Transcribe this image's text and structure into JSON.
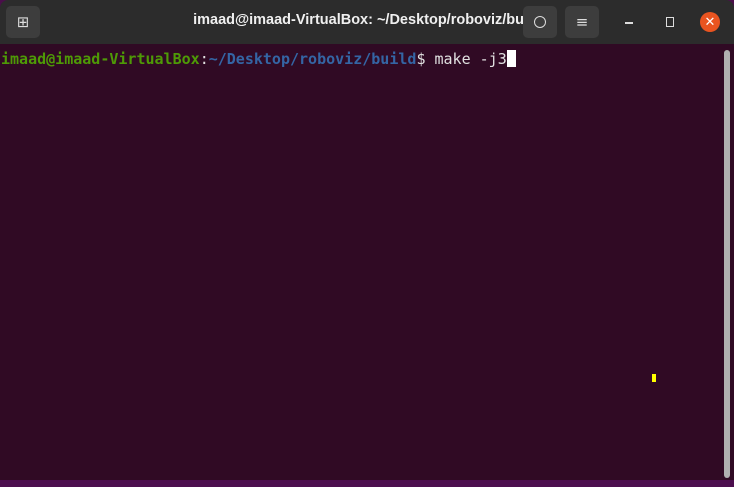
{
  "window": {
    "title": "imaad@imaad-VirtualBox: ~/Desktop/roboviz/build"
  },
  "terminal": {
    "user_host": "imaad@imaad-VirtualBox",
    "separator": ":",
    "path": "~/Desktop/roboviz/build",
    "prompt_symbol": "$",
    "command": " make -j3"
  },
  "colors": {
    "background": "#300a24",
    "user_host": "#4e9a06",
    "path": "#3465a4",
    "close_button": "#e95420"
  }
}
